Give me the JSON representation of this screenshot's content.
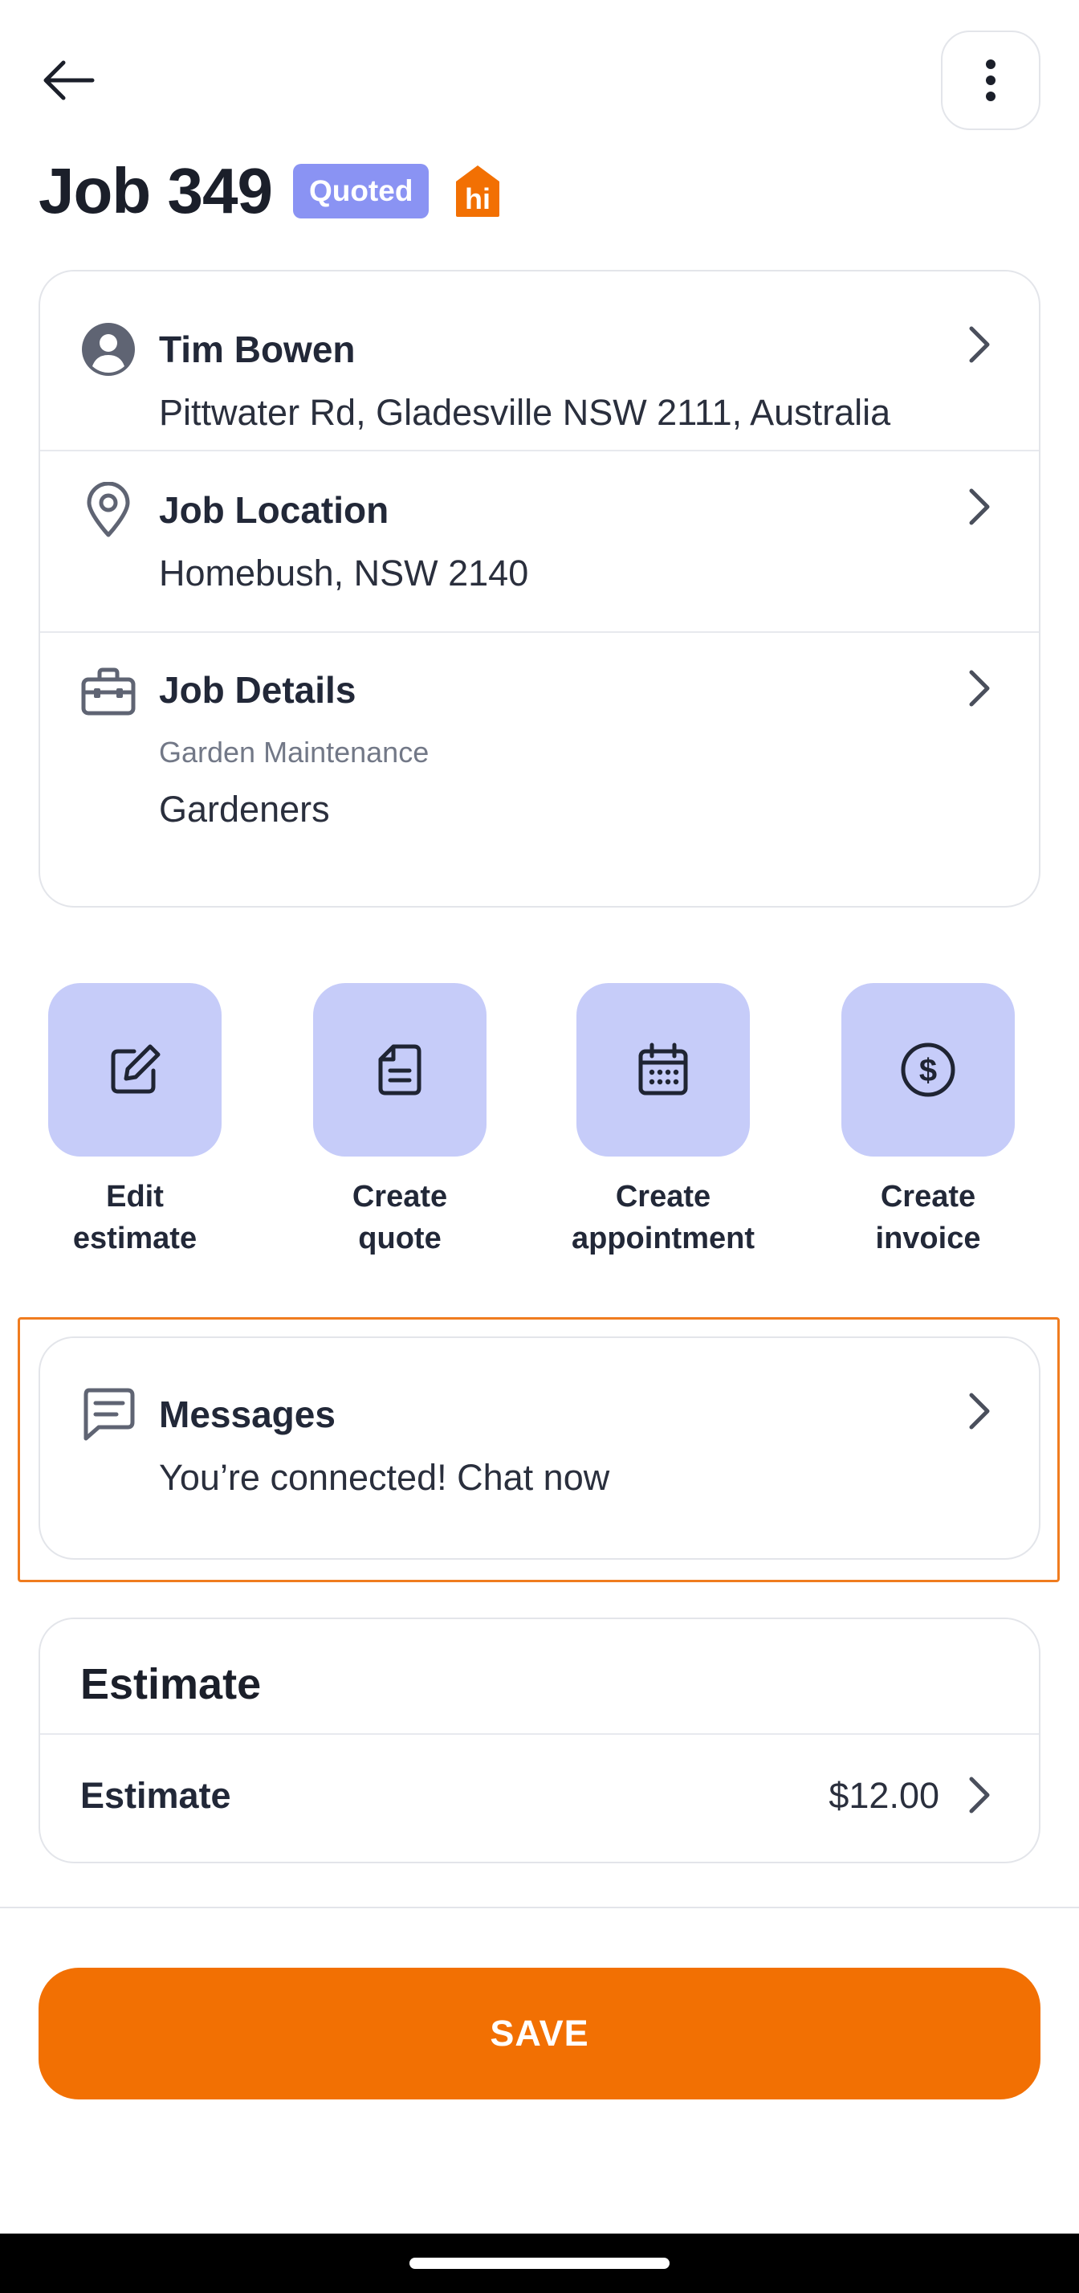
{
  "header": {
    "title": "Job 349",
    "status_badge": "Quoted",
    "brand_logo_text": "hi",
    "back_icon": "arrow-left-icon",
    "menu_icon": "more-vertical-icon"
  },
  "info_card": {
    "customer": {
      "icon": "user-circle-icon",
      "name": "Tim Bowen",
      "address": "Pittwater Rd, Gladesville NSW 2111, Australia"
    },
    "location": {
      "icon": "map-pin-icon",
      "title": "Job Location",
      "value": "Homebush, NSW 2140"
    },
    "details": {
      "icon": "toolbox-icon",
      "title": "Job Details",
      "category": "Garden Maintenance",
      "value": "Gardeners"
    }
  },
  "actions": [
    {
      "icon": "edit-icon",
      "label": "Edit\nestimate"
    },
    {
      "icon": "document-icon",
      "label": "Create\nquote"
    },
    {
      "icon": "calendar-icon",
      "label": "Create\nappointment"
    },
    {
      "icon": "dollar-circle-icon",
      "label": "Create\ninvoice"
    }
  ],
  "messages": {
    "icon": "chat-icon",
    "title": "Messages",
    "subtitle": "You’re connected! Chat now"
  },
  "estimate": {
    "heading": "Estimate",
    "row_label": "Estimate",
    "amount": "$12.00"
  },
  "save_label": "SAVE",
  "colors": {
    "accent": "#f27003",
    "badge": "#8a93f3",
    "action_tile": "#c6ccf9",
    "highlight_outline": "#f07c1f"
  }
}
